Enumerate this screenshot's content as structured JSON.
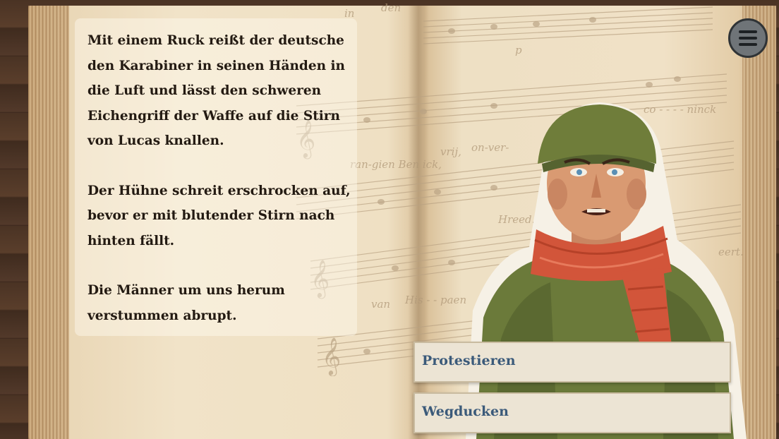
{
  "story": {
    "paragraphs": [
      "Mit einem Ruck reißt der deutsche\nden Karabiner in seinen Händen in\ndie Luft und lässt den schweren\nEichengriff der Waffe auf die Stirn\nvon Lucas knallen.",
      "Der Hühne schreit erschrocken auf,\nbevor er mit blutender Stirn nach\nhinten fällt.",
      "Die Männer um uns herum\nverstummen abrupt."
    ]
  },
  "choices": [
    {
      "label": "Protestieren"
    },
    {
      "label": "Wegducken"
    }
  ],
  "menu": {
    "icon": "hamburger-menu-icon"
  },
  "sheet_music_lyrics": [
    "in",
    "den",
    "p",
    "co - - - - ninck",
    "ran-gien Ben ick,",
    "vrij,",
    "on-ver-",
    "Hreed.",
    "van",
    "His - - paen",
    "eert."
  ],
  "colors": {
    "choice_text": "#3b5a7a",
    "scarf": "#d2553a",
    "jacket": "#6b7a3a"
  }
}
